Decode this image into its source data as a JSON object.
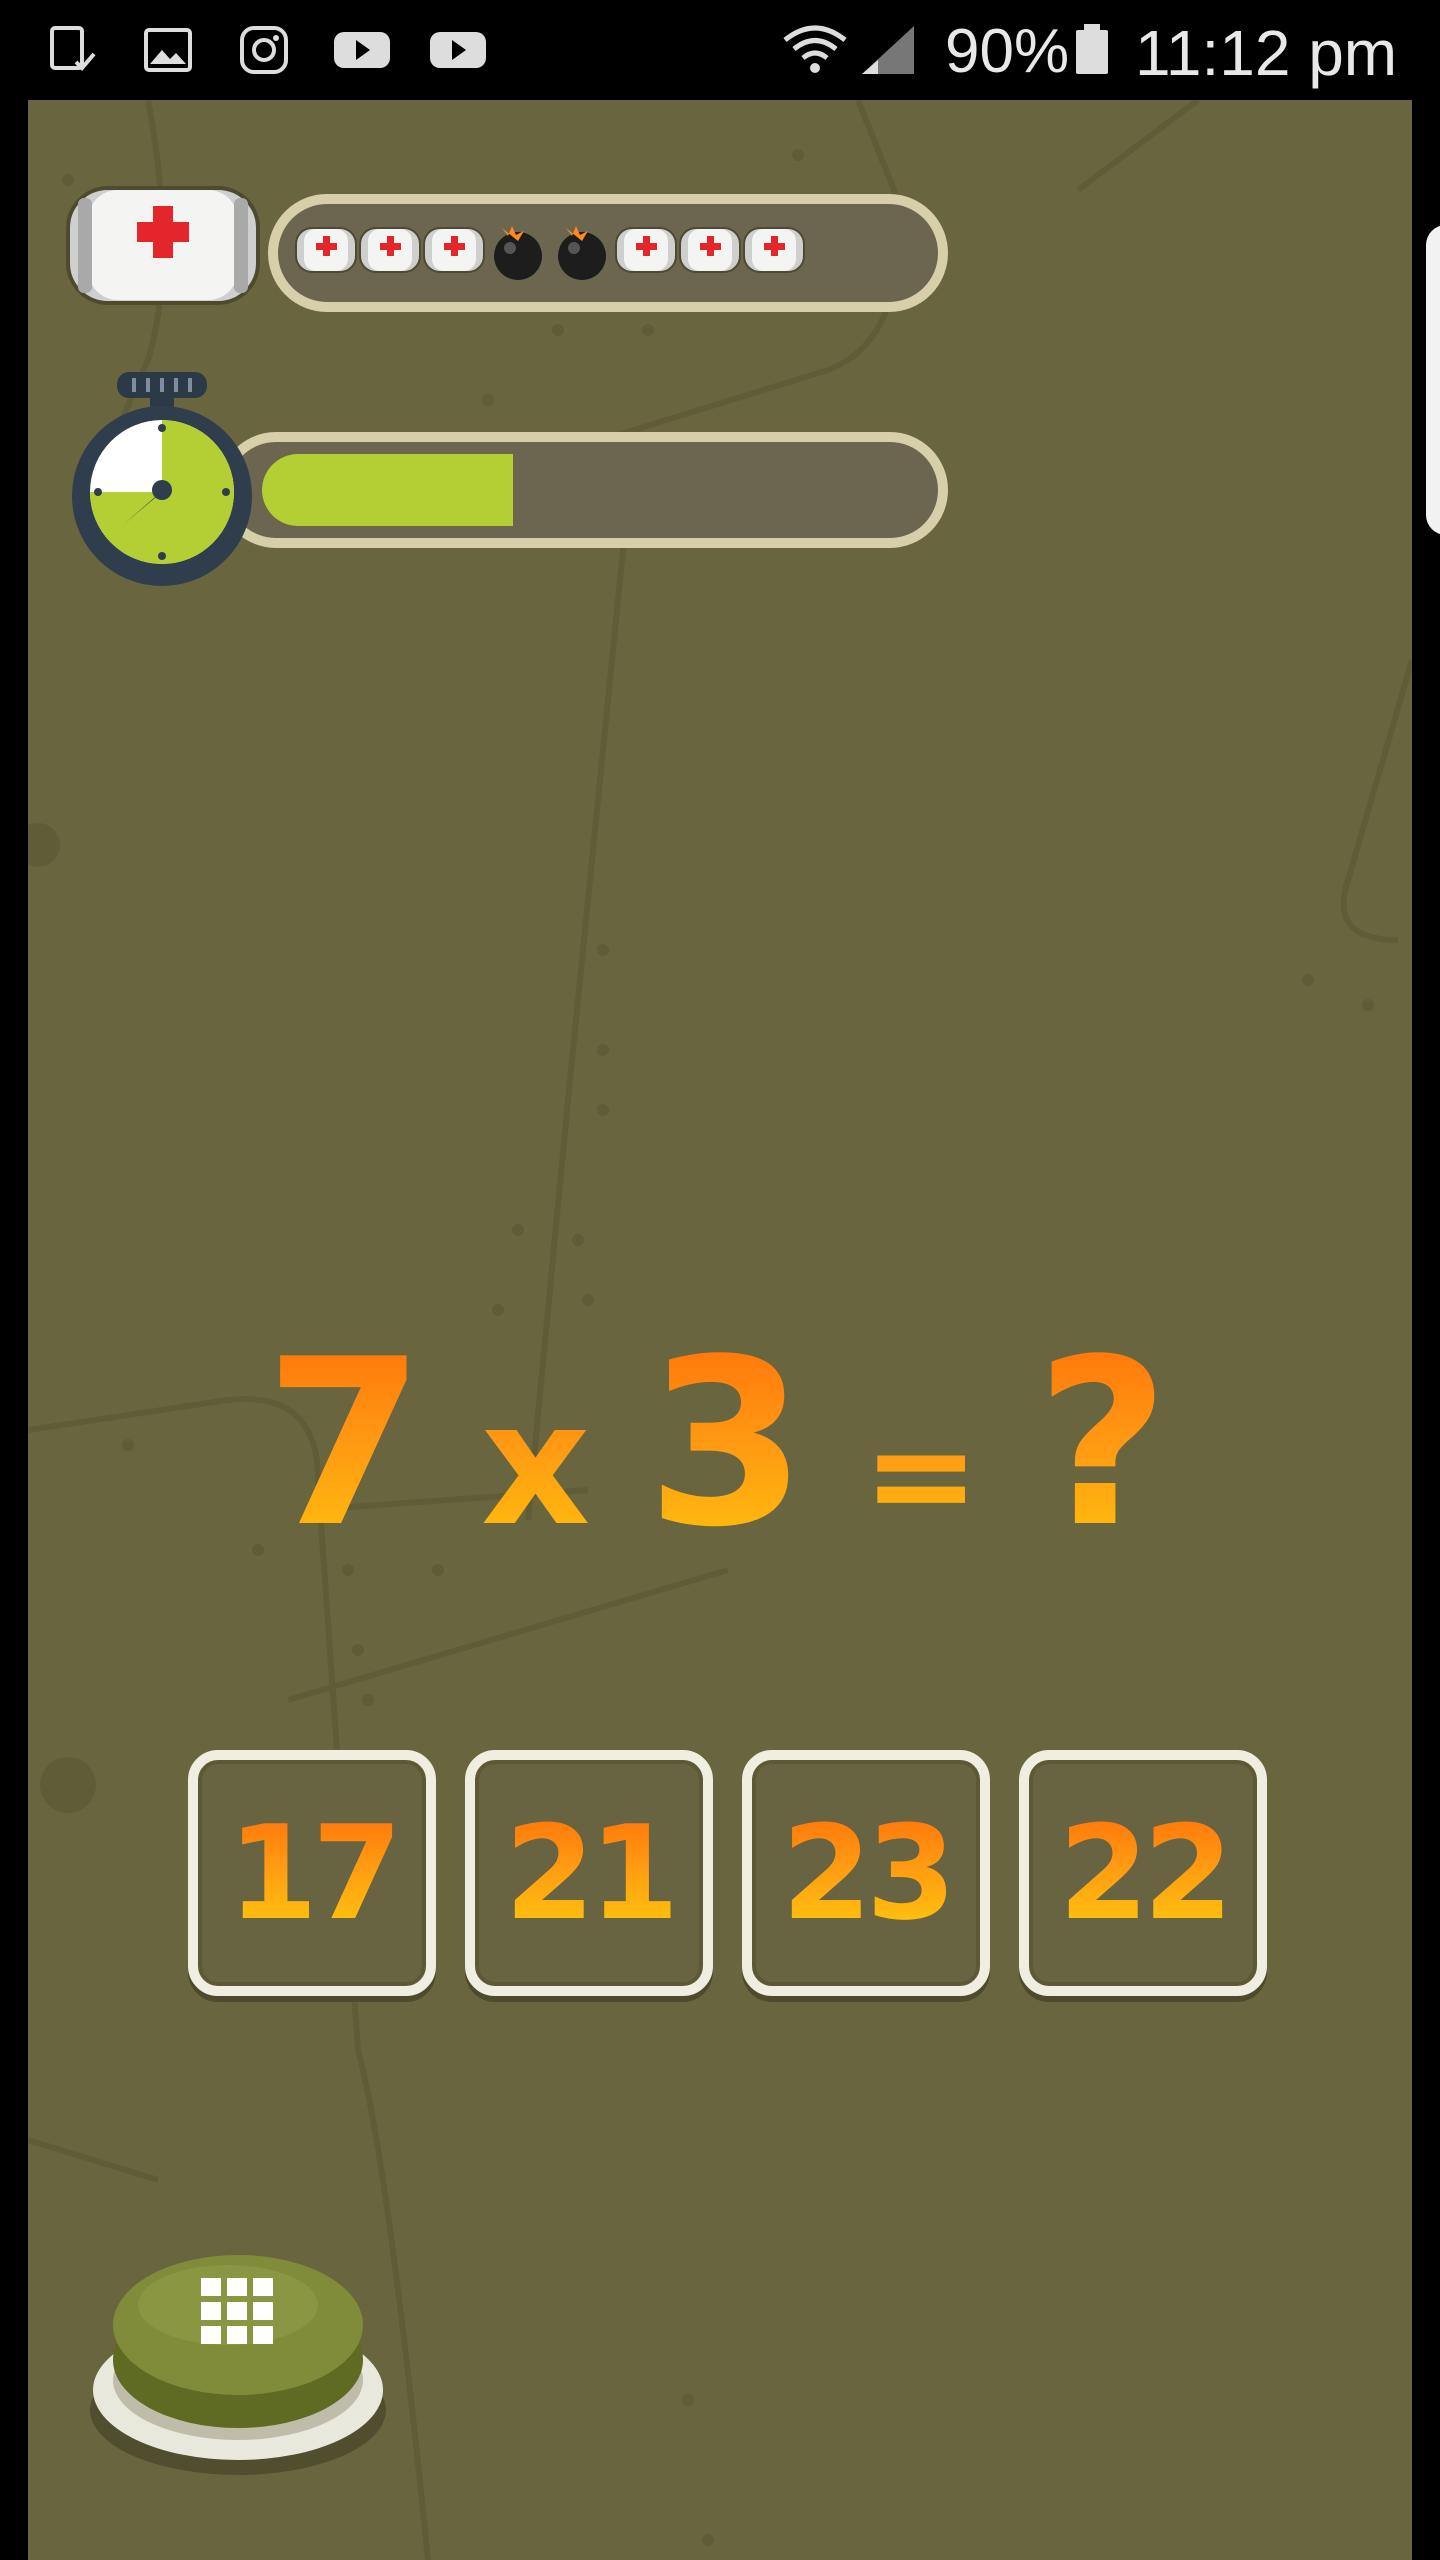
{
  "status_bar": {
    "battery": "90%",
    "time": "11:12 pm",
    "icons": [
      "device-check-icon",
      "gallery-icon",
      "instagram-icon",
      "youtube-icon",
      "youtube-icon",
      "wifi-icon",
      "signal-icon",
      "battery-icon"
    ]
  },
  "lives": {
    "items": [
      "medkit",
      "medkit",
      "medkit",
      "bomb",
      "bomb",
      "medkit",
      "medkit",
      "medkit"
    ]
  },
  "timer": {
    "fraction_remaining": 0.34,
    "fill_color": "#b3cf34"
  },
  "question": {
    "a": "7",
    "op": "x",
    "b": "3",
    "eq": "=",
    "unknown": "?"
  },
  "answers": [
    "17",
    "21",
    "23",
    "22"
  ],
  "menu": {
    "icon": "grid-icon"
  },
  "colors": {
    "background": "#69663f",
    "text_gradient_top": "#ff6a08",
    "text_gradient_bottom": "#ffd20c",
    "frame": "#efeee0"
  }
}
